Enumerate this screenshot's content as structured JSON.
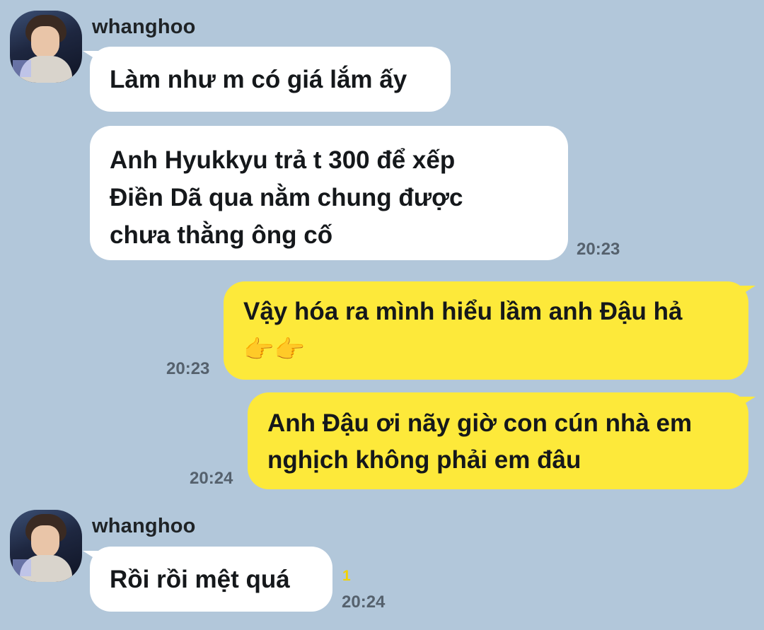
{
  "messages": [
    {
      "sender": "whanghoo",
      "text": "Làm như m có giá lắm ấy"
    },
    {
      "text_lines": [
        "Anh Hyukkyu trả t 300 để xếp",
        "Điền Dã qua nằm chung được",
        "chưa thằng ông cố"
      ],
      "time": "20:23"
    },
    {
      "text": "Vậy hóa ra mình hiểu lầm anh Đậu hả",
      "emoji": "👉👉",
      "time": "20:23"
    },
    {
      "text_lines": [
        "Anh Đậu ơi nãy giờ con cún nhà em",
        "nghịch không phải em đâu"
      ],
      "time": "20:24"
    },
    {
      "sender": "whanghoo",
      "text": "Rồi rồi mệt quá",
      "unread": "1",
      "time": "20:24"
    }
  ],
  "colors": {
    "background": "#b2c7da",
    "incoming_bubble": "#ffffff",
    "outgoing_bubble": "#fde93a",
    "unread_badge": "#f3d200"
  },
  "icons": {
    "avatar": "user-avatar-icon"
  }
}
